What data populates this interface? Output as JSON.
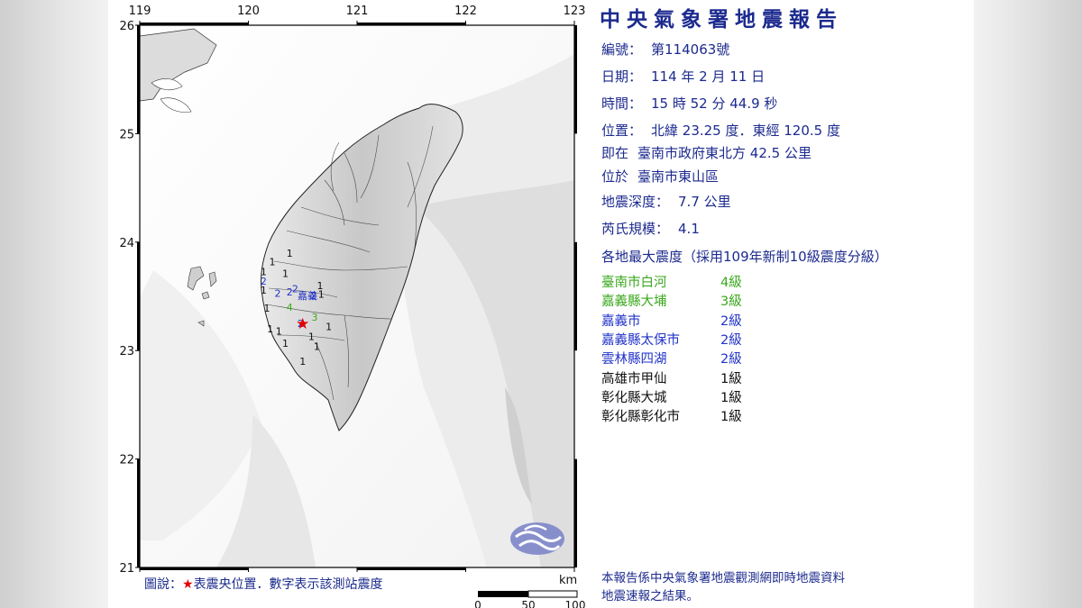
{
  "header": {
    "title": "中央氣象署地震報告"
  },
  "report": {
    "number_label": "編號：",
    "number_value": "第114063號",
    "date_label": "日期：",
    "date_value": "114 年 2 月 11 日",
    "time_label": "時間：",
    "time_value": "15 時 52 分 44.9 秒",
    "position_label": "位置：",
    "position_value": "北緯 23.25 度．東經 120.5 度",
    "relative_label": "即在",
    "relative_value": "臺南市政府東北方 42.5 公里",
    "locate_label": "位於",
    "locate_value": "臺南市東山區",
    "depth_label": "地震深度：",
    "depth_value": "7.7 公里",
    "magnitude_label": "芮氏規模：",
    "magnitude_value": "4.1",
    "intensity_heading": "各地最大震度（採用109年新制10級震度分級）"
  },
  "stations": [
    {
      "name": "臺南市白河",
      "level": "4級",
      "color": "#3aa81c"
    },
    {
      "name": "嘉義縣大埔",
      "level": "3級",
      "color": "#3aa81c"
    },
    {
      "name": "嘉義市",
      "level": "2級",
      "color": "#2233c8"
    },
    {
      "name": "嘉義縣太保市",
      "level": "2級",
      "color": "#2233c8"
    },
    {
      "name": "雲林縣四湖",
      "level": "2級",
      "color": "#2233c8"
    },
    {
      "name": "高雄市甲仙",
      "level": "1級",
      "color": "#111111"
    },
    {
      "name": "彰化縣大城",
      "level": "1級",
      "color": "#111111"
    },
    {
      "name": "彰化縣彰化市",
      "level": "1級",
      "color": "#111111"
    }
  ],
  "map": {
    "lon_ticks": [
      "119",
      "120",
      "121",
      "122",
      "123"
    ],
    "lat_ticks": [
      "26",
      "25",
      "24",
      "23",
      "22",
      "21"
    ],
    "city_label": "嘉義",
    "epicenter": {
      "lat": 23.25,
      "lon": 120.5
    },
    "intensity_marks": [
      {
        "text": "1",
        "lon": 120.38,
        "lat": 23.9
      },
      {
        "text": "1",
        "lon": 120.22,
        "lat": 23.82
      },
      {
        "text": "1",
        "lon": 120.14,
        "lat": 23.73
      },
      {
        "text": "1",
        "lon": 120.34,
        "lat": 23.71
      },
      {
        "text": "2",
        "lon": 120.14,
        "lat": 23.64
      },
      {
        "text": "1",
        "lon": 120.14,
        "lat": 23.56
      },
      {
        "text": "2",
        "lon": 120.27,
        "lat": 23.53
      },
      {
        "text": "2",
        "lon": 120.38,
        "lat": 23.54
      },
      {
        "text": "2",
        "lon": 120.43,
        "lat": 23.57
      },
      {
        "text": "2",
        "lon": 120.6,
        "lat": 23.51
      },
      {
        "text": "1",
        "lon": 120.66,
        "lat": 23.6
      },
      {
        "text": "1",
        "lon": 120.67,
        "lat": 23.52
      },
      {
        "text": "1",
        "lon": 120.17,
        "lat": 23.39
      },
      {
        "text": "4",
        "lon": 120.38,
        "lat": 23.4
      },
      {
        "text": "3",
        "lon": 120.61,
        "lat": 23.31
      },
      {
        "text": "2",
        "lon": 120.48,
        "lat": 23.25
      },
      {
        "text": "1",
        "lon": 120.74,
        "lat": 23.22
      },
      {
        "text": "1",
        "lon": 120.2,
        "lat": 23.2
      },
      {
        "text": "1",
        "lon": 120.28,
        "lat": 23.18
      },
      {
        "text": "1",
        "lon": 120.58,
        "lat": 23.13
      },
      {
        "text": "1",
        "lon": 120.34,
        "lat": 23.07
      },
      {
        "text": "1",
        "lon": 120.63,
        "lat": 23.04
      },
      {
        "text": "1",
        "lon": 120.5,
        "lat": 22.9
      }
    ],
    "scale_unit": "km",
    "scale_ticks": [
      "0",
      "50",
      "100"
    ]
  },
  "legend": {
    "prefix": "圖說：",
    "star": "★",
    "text": "表震央位置．數字表示該測站震度"
  },
  "footer": {
    "line1": "本報告係中央氣象署地震觀測網即時地震資料",
    "line2": "地震速報之結果。"
  }
}
